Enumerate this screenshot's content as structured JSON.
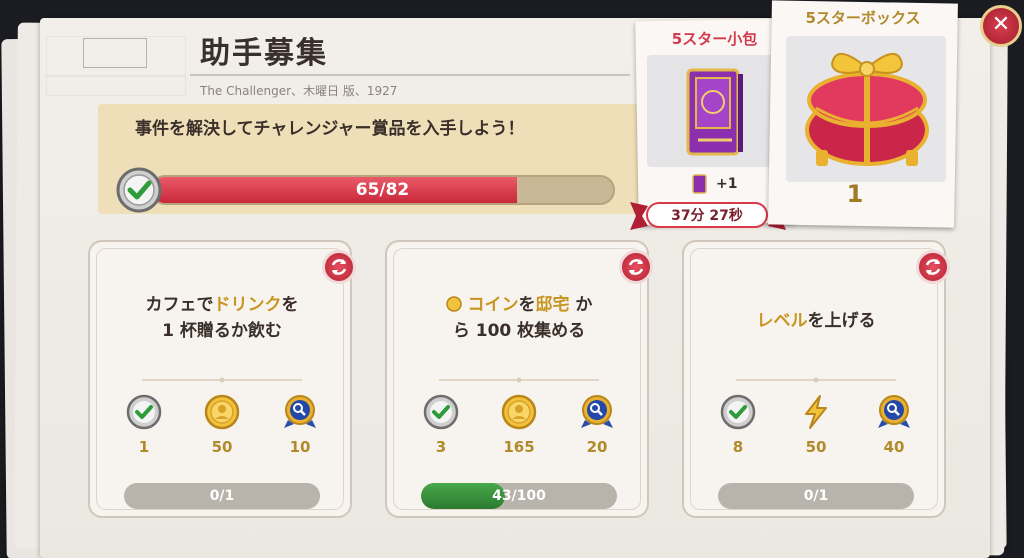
{
  "header": {
    "title": "助手募集",
    "subtitle": "The Challenger、木曜日 版、1927"
  },
  "goal": {
    "text": "事件を解決してチャレンジャー賞品を入手しよう！",
    "progress_label": "65/82",
    "progress_current": 65,
    "progress_total": 82
  },
  "rewards": {
    "small": {
      "title": "5スター小包",
      "bonus": "+1",
      "timer": "37分 27秒"
    },
    "box": {
      "title": "5スターボックス",
      "count": "1"
    }
  },
  "tasks": [
    {
      "text_parts": [
        "カフェで",
        "ドリンク",
        "を",
        "1 杯贈るか飲む"
      ],
      "rewards": [
        {
          "icon": "check-badge-icon",
          "value": "1"
        },
        {
          "icon": "coin-icon",
          "value": "50"
        },
        {
          "icon": "magnifier-medal-icon",
          "value": "10"
        }
      ],
      "progress_label": "0/1",
      "progress_current": 0,
      "progress_total": 1
    },
    {
      "text_parts": [
        "コイン",
        "を",
        "邸宅",
        " か",
        "ら 100 枚集める"
      ],
      "rewards": [
        {
          "icon": "check-badge-icon",
          "value": "3"
        },
        {
          "icon": "coin-icon",
          "value": "165"
        },
        {
          "icon": "magnifier-medal-icon",
          "value": "20"
        }
      ],
      "progress_label": "43/100",
      "progress_current": 43,
      "progress_total": 100
    },
    {
      "text_parts": [
        "レベル",
        "を上げる"
      ],
      "rewards": [
        {
          "icon": "check-badge-icon",
          "value": "8"
        },
        {
          "icon": "lightning-icon",
          "value": "50"
        },
        {
          "icon": "magnifier-medal-icon",
          "value": "40"
        }
      ],
      "progress_label": "0/1",
      "progress_current": 0,
      "progress_total": 1
    }
  ],
  "colors": {
    "accent_red": "#d93a4b",
    "gold": "#c8941f",
    "progress_green": "#2c7a30"
  }
}
